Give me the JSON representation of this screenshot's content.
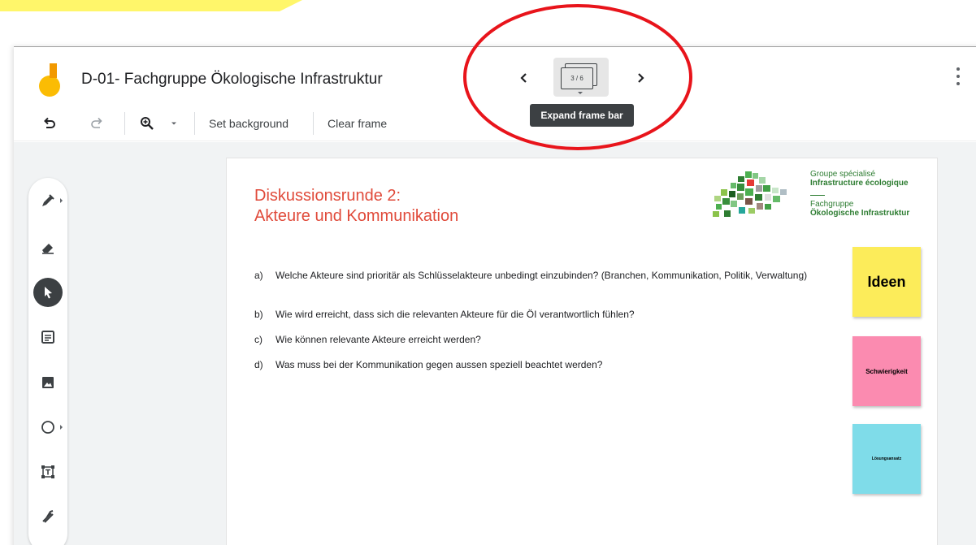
{
  "app": {
    "title": "D-01- Fachgruppe Ökologische Infrastruktur",
    "frame_counter": "3 / 6",
    "tooltip": "Expand frame bar"
  },
  "toolbar": {
    "set_background_label": "Set background",
    "clear_frame_label": "Clear frame"
  },
  "tools": [
    {
      "name": "pen-icon",
      "active": false
    },
    {
      "name": "eraser-icon",
      "active": false
    },
    {
      "name": "select-icon",
      "active": true
    },
    {
      "name": "sticky-note-icon",
      "active": false
    },
    {
      "name": "image-icon",
      "active": false
    },
    {
      "name": "circle-shape-icon",
      "active": false
    },
    {
      "name": "text-box-icon",
      "active": false
    },
    {
      "name": "laser-pointer-icon",
      "active": false
    }
  ],
  "slide": {
    "title_line1": "Diskussionsrunde 2:",
    "title_line2": "Akteure und Kommunikation",
    "org": {
      "fr_line1": "Groupe spécialisé",
      "fr_line2": "Infrastructure écologique",
      "de_line1": "Fachgruppe",
      "de_line2": "Ökologische Infrastruktur"
    },
    "questions": [
      {
        "letter": "a)",
        "text": "Welche Akteure sind prioritär als Schlüsselakteure unbedingt einzubinden? (Branchen, Kommunikation, Politik, Verwaltung)"
      },
      {
        "letter": "b)",
        "text": "Wie wird erreicht, dass sich die relevanten Akteure für die ÖI verantwortlich fühlen?"
      },
      {
        "letter": "c)",
        "text": "Wie können relevante Akteure erreicht werden?"
      },
      {
        "letter": "d)",
        "text": "Was muss bei der Kommunikation gegen aussen speziell beachtet werden?"
      }
    ],
    "stickies": {
      "yellow": "Ideen",
      "pink": "Schwierigkeit",
      "cyan": "Lösungsansatz"
    }
  },
  "colors": {
    "title_red": "#e04a3a",
    "org_green": "#2e7d32",
    "sticky_yellow": "#fcec5a",
    "sticky_pink": "#fb8bb0",
    "sticky_cyan": "#7fdce9",
    "annotation_red": "#e8141b",
    "highlight_yellow": "#fff66a"
  }
}
